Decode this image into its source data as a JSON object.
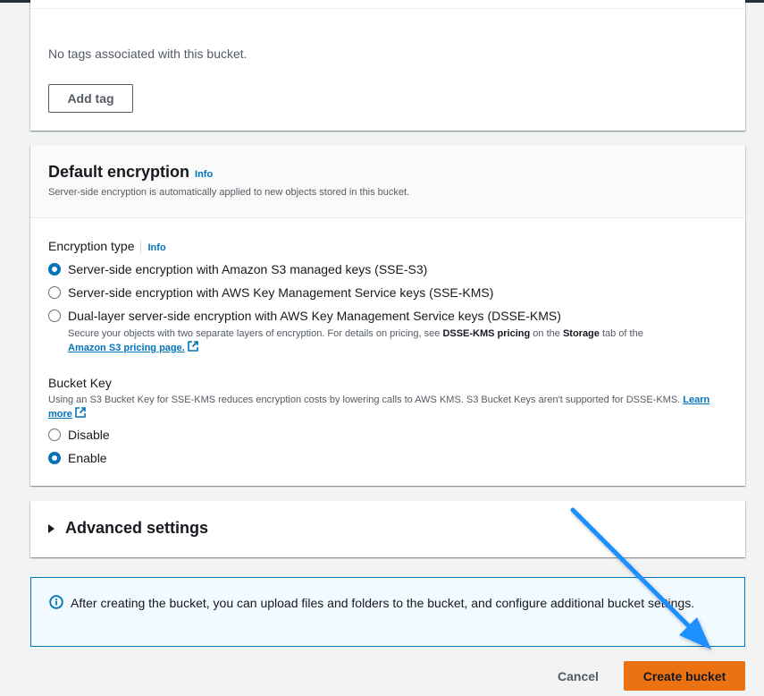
{
  "tags": {
    "empty_text": "No tags associated with this bucket.",
    "add_tag_label": "Add tag"
  },
  "encryption": {
    "title": "Default encryption",
    "info": "Info",
    "description": "Server-side encryption is automatically applied to new objects stored in this bucket.",
    "type_label": "Encryption type",
    "type_info": "Info",
    "options": [
      {
        "label": "Server-side encryption with Amazon S3 managed keys (SSE-S3)",
        "selected": true
      },
      {
        "label": "Server-side encryption with AWS Key Management Service keys (SSE-KMS)",
        "selected": false
      },
      {
        "label": "Dual-layer server-side encryption with AWS Key Management Service keys (DSSE-KMS)",
        "selected": false
      }
    ],
    "dsse_desc_prefix": "Secure your objects with two separate layers of encryption. For details on pricing, see ",
    "dsse_desc_bold1": "DSSE-KMS pricing",
    "dsse_desc_mid": " on the ",
    "dsse_desc_bold2": "Storage",
    "dsse_desc_suffix": " tab of the",
    "dsse_link": "Amazon S3 pricing page.",
    "bucket_key_label": "Bucket Key",
    "bucket_key_desc": "Using an S3 Bucket Key for SSE-KMS reduces encryption costs by lowering calls to AWS KMS. S3 Bucket Keys aren't supported for DSSE-KMS.",
    "learn_more": "Learn more",
    "bucket_key_options": [
      {
        "label": "Disable",
        "selected": false
      },
      {
        "label": "Enable",
        "selected": true
      }
    ]
  },
  "advanced": {
    "title": "Advanced settings"
  },
  "alert": {
    "text": "After creating the bucket, you can upload files and folders to the bucket, and configure additional bucket settings."
  },
  "actions": {
    "cancel": "Cancel",
    "create": "Create bucket"
  },
  "colors": {
    "accent": "#0073bb",
    "primary_button": "#ec7211",
    "annotation_arrow": "#1e90ff"
  },
  "icons": {
    "info_alert": "info-circle-icon",
    "external_link": "external-link-icon",
    "expand": "caret-right-icon"
  }
}
